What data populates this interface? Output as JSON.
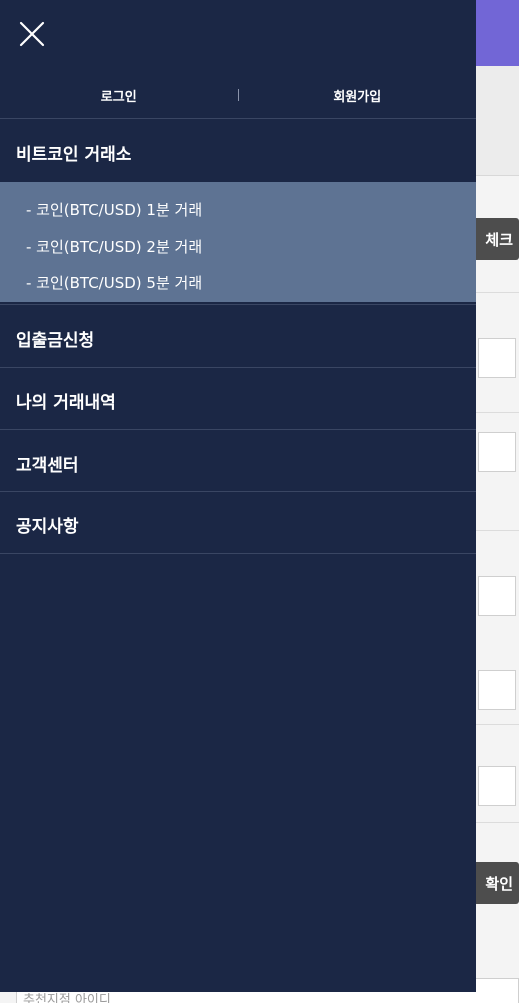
{
  "drawer": {
    "auth": {
      "login": "로그인",
      "signup": "회원가입"
    },
    "menu": {
      "exchange": "비트코인 거래소",
      "submenu": [
        "- 코인(BTC/USD) 1분 거래",
        "- 코인(BTC/USD) 2분 거래",
        "- 코인(BTC/USD) 5분 거래"
      ],
      "deposit_withdraw": "입출금신청",
      "my_trades": "나의 거래내역",
      "support": "고객센터",
      "notice": "공지사항"
    }
  },
  "background": {
    "check_button": "체크",
    "confirm_button": "확인",
    "referrer_placeholder": "추천지점 아이디"
  },
  "colors": {
    "drawer_bg": "#1b2745",
    "submenu_bg": "#5e7393",
    "header_accent": "#7266d6"
  }
}
